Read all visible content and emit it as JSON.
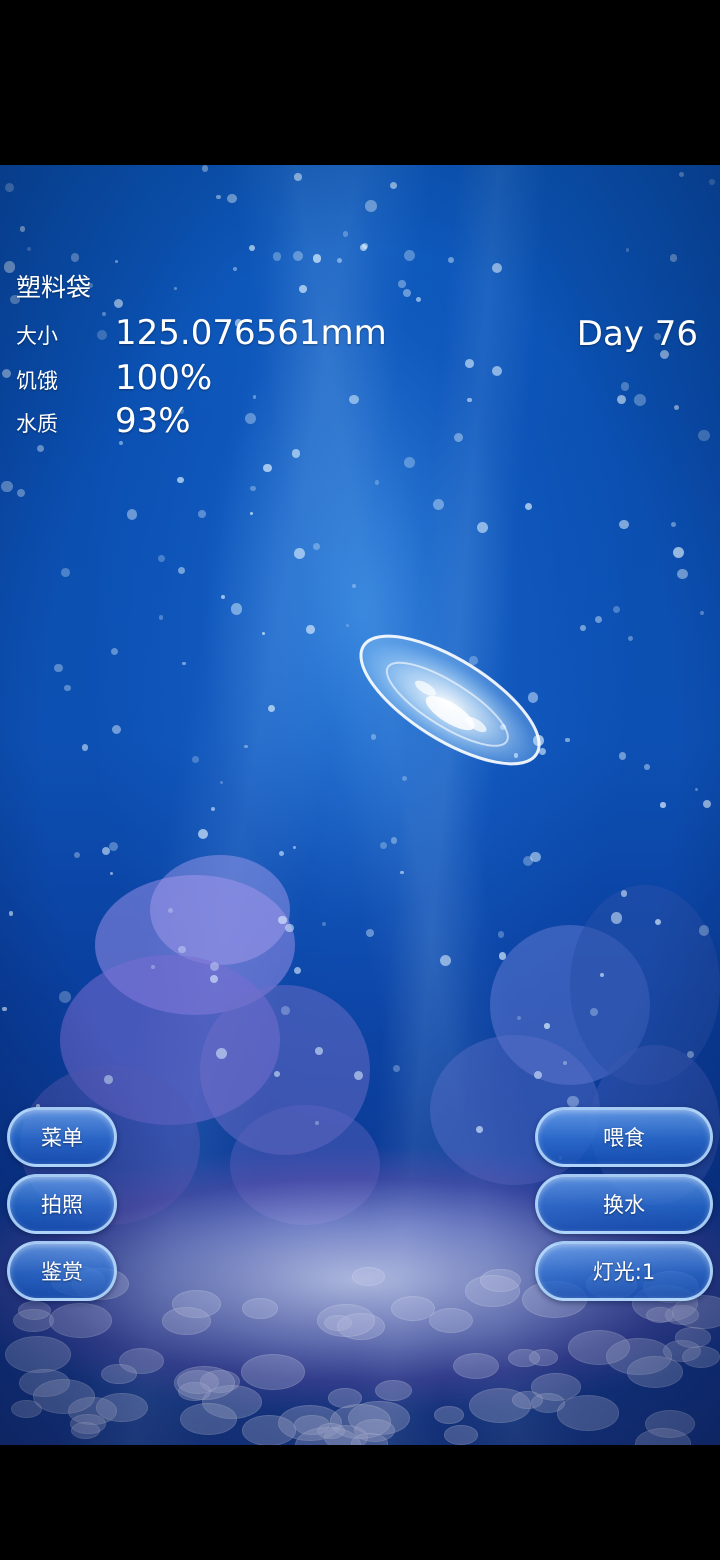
{
  "hud": {
    "name": "塑料袋",
    "size_label": "大小",
    "size_value": "125.076561mm",
    "hunger_label": "饥饿",
    "hunger_value": "100%",
    "water_label": "水质",
    "water_value": "93%",
    "day": "Day 76"
  },
  "left_buttons": {
    "menu": "菜单",
    "photo": "拍照",
    "appreciate": "鉴赏"
  },
  "right_buttons": {
    "feed": "喂食",
    "change_water": "换水",
    "light": "灯光:1"
  },
  "colors": {
    "water_top": "#0b57b8",
    "water_bottom": "#1a3c8c",
    "button_border": "#bee1ff",
    "text": "#ffffff"
  }
}
